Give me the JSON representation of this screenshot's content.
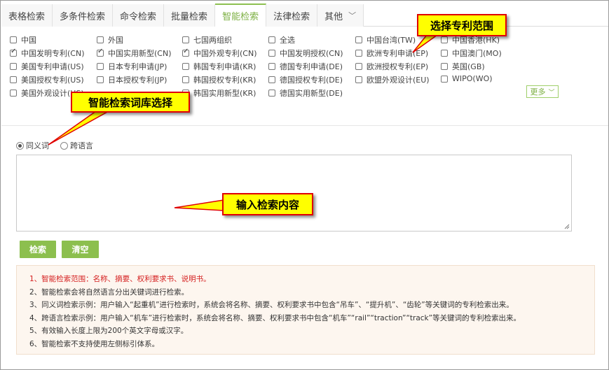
{
  "tabs": [
    {
      "label": "表格检索",
      "active": false
    },
    {
      "label": "多条件检索",
      "active": false
    },
    {
      "label": "命令检索",
      "active": false
    },
    {
      "label": "批量检索",
      "active": false
    },
    {
      "label": "智能检索",
      "active": true
    },
    {
      "label": "法律检索",
      "active": false
    },
    {
      "label": "其他",
      "active": false
    }
  ],
  "scope": {
    "columns": [
      [
        {
          "label": "中国",
          "checked": false
        },
        {
          "label": "中国发明专利(CN)",
          "checked": true
        },
        {
          "label": "美国专利申请(US)",
          "checked": false
        },
        {
          "label": "美国授权专利(US)",
          "checked": false
        },
        {
          "label": "美国外观设计(US)",
          "checked": false
        }
      ],
      [
        {
          "label": "外国",
          "checked": false
        },
        {
          "label": "中国实用新型(CN)",
          "checked": true
        },
        {
          "label": "日本专利申请(JP)",
          "checked": false
        },
        {
          "label": "日本授权专利(JP)",
          "checked": false
        }
      ],
      [
        {
          "label": "七国两组织",
          "checked": false
        },
        {
          "label": "中国外观专利(CN)",
          "checked": true
        },
        {
          "label": "韩国专利申请(KR)",
          "checked": false
        },
        {
          "label": "韩国授权专利(KR)",
          "checked": false
        },
        {
          "label": "韩国实用新型(KR)",
          "checked": false
        }
      ],
      [
        {
          "label": "全选",
          "checked": false
        },
        {
          "label": "中国发明授权(CN)",
          "checked": false
        },
        {
          "label": "德国专利申请(DE)",
          "checked": false
        },
        {
          "label": "德国授权专利(DE)",
          "checked": false
        },
        {
          "label": "德国实用新型(DE)",
          "checked": false
        }
      ],
      [
        {
          "label": "中国台湾(TW)",
          "checked": false
        },
        {
          "label": "欧洲专利申请(EP)",
          "checked": false
        },
        {
          "label": "欧洲授权专利(EP)",
          "checked": false
        },
        {
          "label": "欧盟外观设计(EU)",
          "checked": false
        }
      ],
      [
        {
          "label": "中国香港(HK)",
          "checked": false
        },
        {
          "label": "中国澳门(MO)",
          "checked": false
        },
        {
          "label": "英国(GB)",
          "checked": false
        },
        {
          "label": "WIPO(WO)",
          "checked": false
        }
      ]
    ],
    "more_label": "更多"
  },
  "mode": {
    "options": [
      {
        "label": "同义词",
        "selected": true
      },
      {
        "label": "跨语言",
        "selected": false
      }
    ]
  },
  "query": {
    "value": ""
  },
  "actions": {
    "search_label": "检索",
    "clear_label": "清空"
  },
  "notes": [
    "1、智能检索范围：名称、摘要、权利要求书、说明书。",
    "2、智能检索会将自然语言分出关键词进行检索。",
    "3、同义词检索示例：用户输入“起重机”进行检索时，系统会将名称、摘要、权利要求书中包含“吊车”、“提升机”、“齿轮”等关键词的专利检索出来。",
    "4、跨语言检索示例：用户输入“机车”进行检索时，系统会将名称、摘要、权利要求书中包含“机车”“rail”“traction”“track”等关键词的专利检索出来。",
    "5、有效输入长度上限为200个英文字母或汉字。",
    "6、智能检索不支持使用左侧标引体系。"
  ],
  "callouts": {
    "scope": "选择专利范围",
    "library": "智能检索词库选择",
    "input": "输入检索内容"
  },
  "colors": {
    "accent": "#8cbf4e",
    "note_highlight": "#d52020",
    "callout_fill": "#ffff00",
    "callout_border": "#e00000"
  }
}
